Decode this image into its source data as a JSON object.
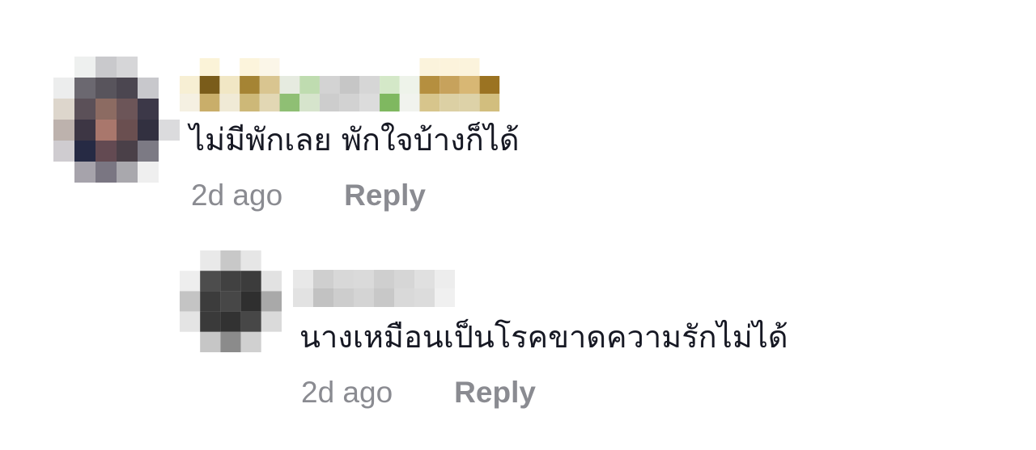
{
  "comments": [
    {
      "author": "",
      "text": "ไม่มีพักเลย พักใจบ้างก็ได้",
      "timestamp": "2d ago",
      "reply_label": "Reply"
    },
    {
      "author": "",
      "text": "นางเหมือนเป็นโรคขาดความรักไม่ได้",
      "timestamp": "2d ago",
      "reply_label": "Reply"
    }
  ]
}
